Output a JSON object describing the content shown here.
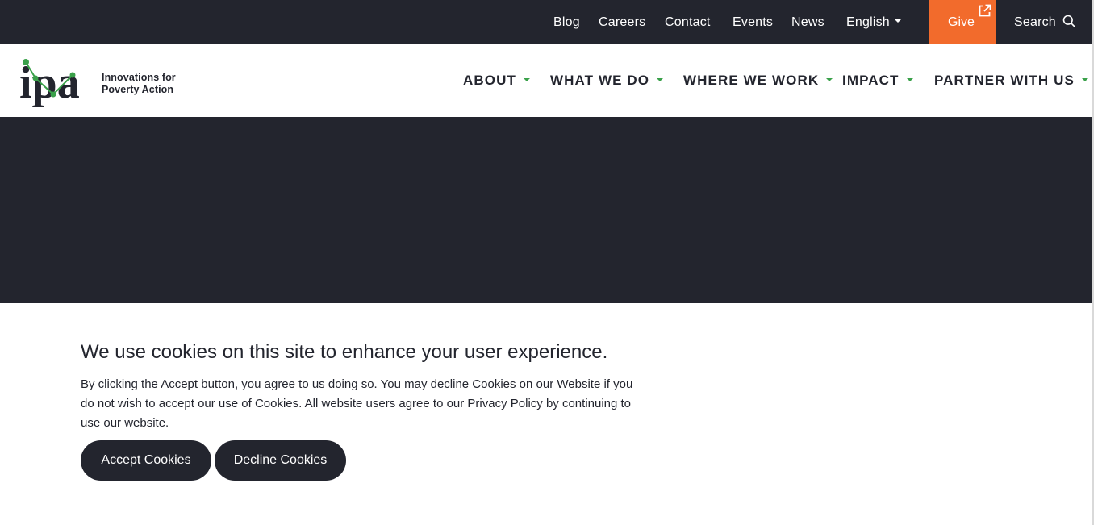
{
  "utility_nav": {
    "links": [
      "Blog",
      "Careers",
      "Contact",
      "Events",
      "News"
    ],
    "language": "English",
    "give_label": "Give",
    "search_label": "Search"
  },
  "logo": {
    "letters": "ipa",
    "line1": "Innovations for",
    "line2": "Poverty Action"
  },
  "main_nav": {
    "items": [
      "ABOUT",
      "WHAT WE DO",
      "WHERE WE WORK",
      "IMPACT",
      "PARTNER WITH US"
    ]
  },
  "cookie": {
    "title": "We use cookies on this site to enhance your user experience.",
    "body": "By clicking the Accept button, you agree to us doing so. You may decline Cookies on our Website if you do not wish to accept our use of Cookies. All website users agree to our Privacy Policy by continuing to use our website.",
    "accept_label": "Accept Cookies",
    "decline_label": "Decline Cookies"
  },
  "colors": {
    "dark": "#23252e",
    "give_orange": "#f26b2c",
    "accent_green": "#3aa14a"
  },
  "icons": {
    "external": "external-link-icon",
    "search": "search-icon",
    "caret": "caret-down-icon"
  }
}
